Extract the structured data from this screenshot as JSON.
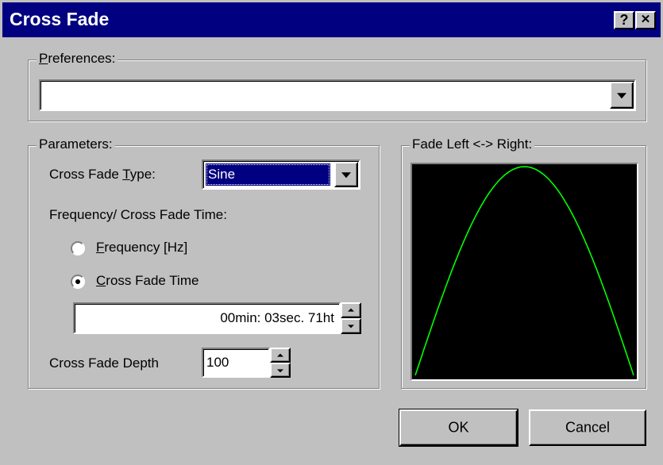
{
  "window": {
    "title": "Cross Fade",
    "help_label": "?",
    "close_label": "✕"
  },
  "preferences": {
    "legend": "Preferences:",
    "selected_value": ""
  },
  "parameters": {
    "legend": "Parameters:",
    "cross_fade_type_label": "Cross Fade Type:",
    "cross_fade_type_value": "Sine",
    "freq_time_label": "Frequency/ Cross Fade Time:",
    "frequency_radio_label": "Frequency [Hz]",
    "cross_fade_time_radio_label": "Cross Fade Time",
    "selected_mode": "Cross Fade Time",
    "time_value": "00min: 03sec. 71ht",
    "depth_label": "Cross Fade Depth",
    "depth_value": "100"
  },
  "preview": {
    "legend": "Fade Left <-> Right:",
    "curve_color": "#00ff00",
    "background_color": "#000000"
  },
  "buttons": {
    "ok_label": "OK",
    "cancel_label": "Cancel"
  },
  "colors": {
    "title_bar": "#000080",
    "face": "#c0c0c0",
    "selection": "#000080"
  }
}
